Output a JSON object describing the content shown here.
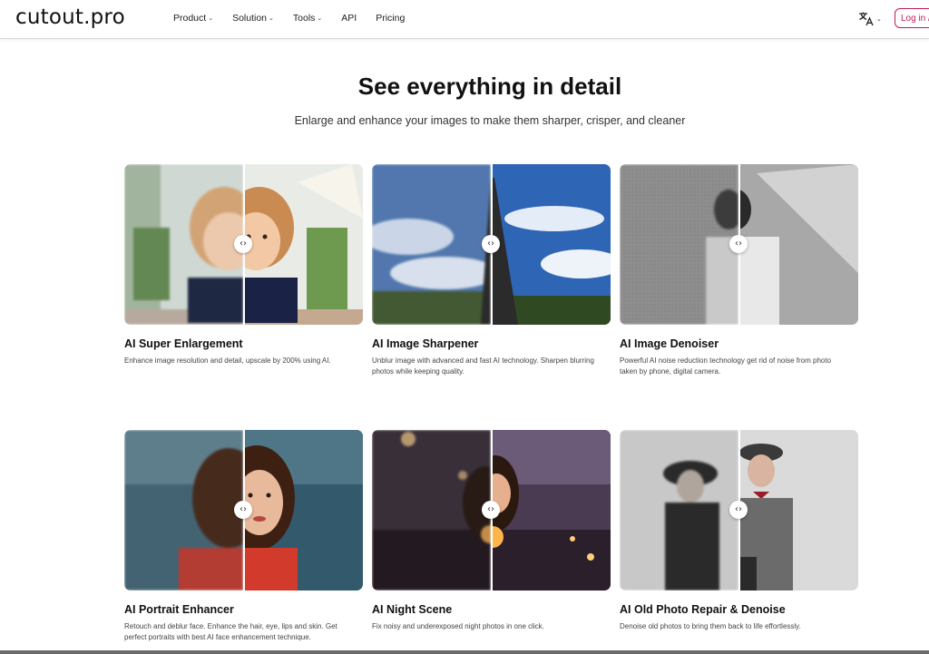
{
  "header": {
    "logo": "cutout.pro",
    "nav": [
      {
        "label": "Product",
        "dropdown": true
      },
      {
        "label": "Solution",
        "dropdown": true
      },
      {
        "label": "Tools",
        "dropdown": true
      },
      {
        "label": "API",
        "dropdown": false
      },
      {
        "label": "Pricing",
        "dropdown": false
      }
    ],
    "language_icon": "translate-icon",
    "login_label": "Log in /"
  },
  "hero": {
    "title": "See everything in detail",
    "subtitle": "Enlarge and enhance your images to make them sharper, crisper, and cleaner"
  },
  "cards": [
    {
      "title": "AI Super Enlargement",
      "description": "Enhance image resolution and detail, upscale by 200% using AI."
    },
    {
      "title": "AI Image Sharpener",
      "description": "Unblur image with advanced and fast AI technology. Sharpen blurring photos while keeping quality."
    },
    {
      "title": "AI Image Denoiser",
      "description": "Powerful AI noise reduction technology get rid of noise from photo taken by phone, digital camera."
    },
    {
      "title": "AI Portrait Enhancer",
      "description": "Retouch and deblur face. Enhance the hair, eye, lips and skin. Get perfect portraits with best AI face enhancement technique."
    },
    {
      "title": "AI Night Scene",
      "description": "Fix noisy and underexposed night photos in one click."
    },
    {
      "title": "AI Old Photo Repair & Denoise",
      "description": "Denoise old photos to bring them back to life effortlessly."
    }
  ],
  "compare_handle_glyph": "‹›",
  "colors": {
    "accent": "#c2185b"
  }
}
